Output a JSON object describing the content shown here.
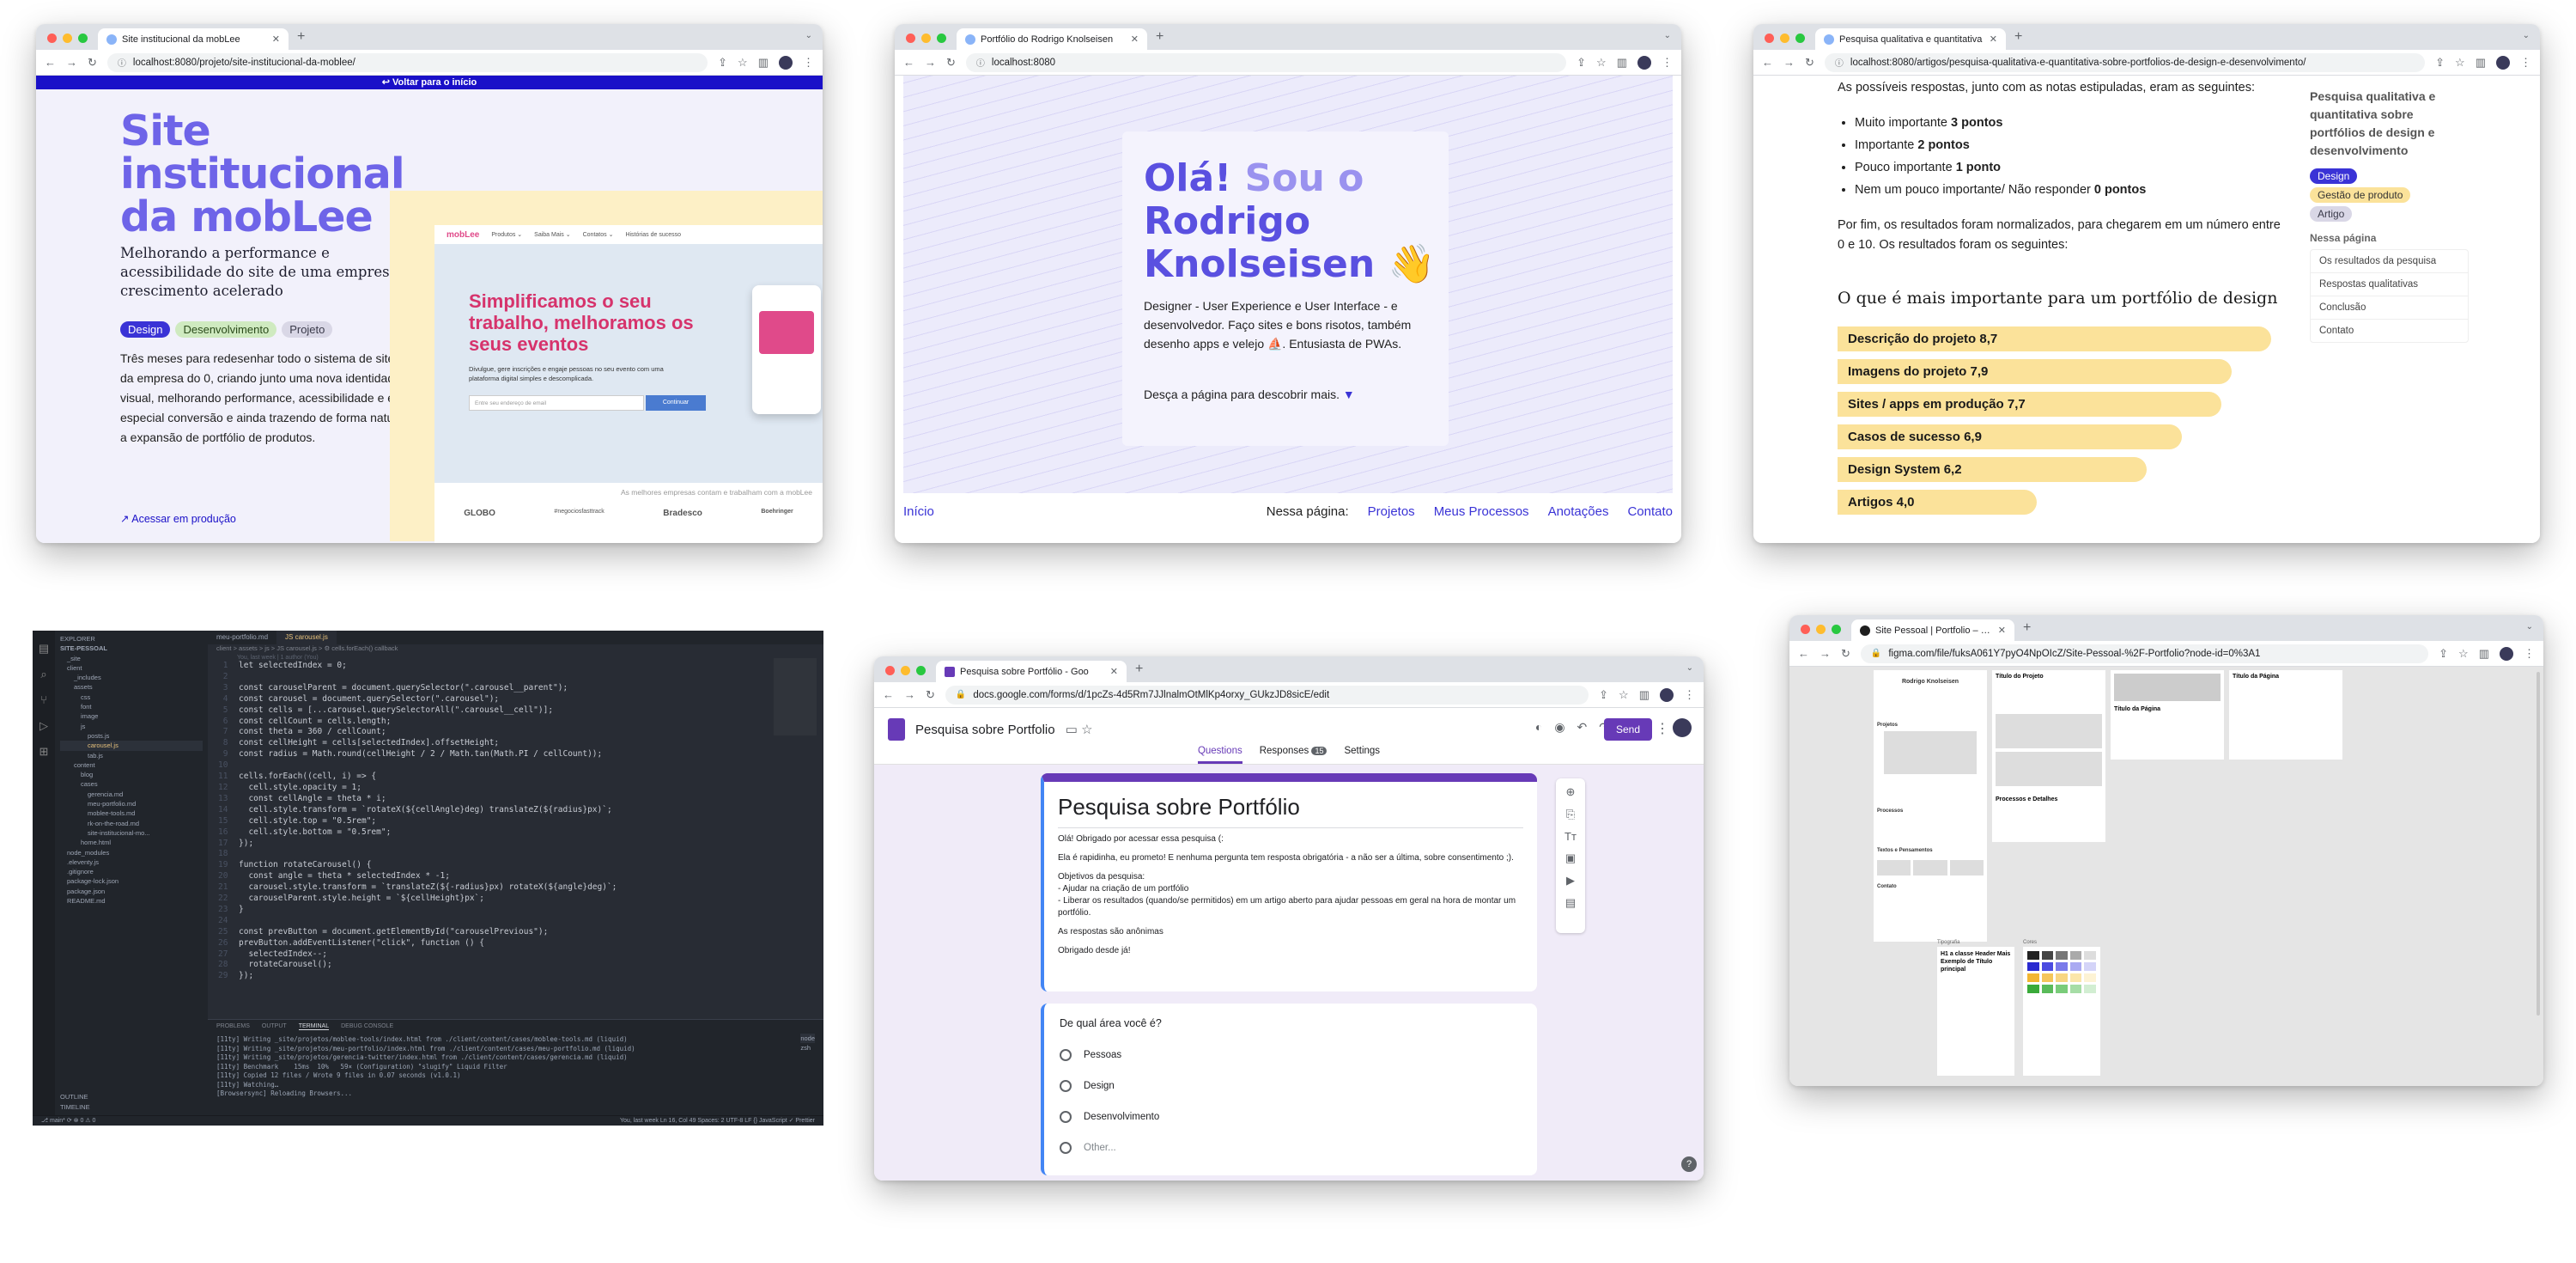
{
  "w1": {
    "tab_title": "Site institucional da mobLee",
    "url": "localhost:8080/projeto/site-institucional-da-moblee/",
    "banner": "↩ Voltar para o início",
    "title_lines": [
      "Site",
      "institucional",
      "da mobLee"
    ],
    "subtitle": "Melhorando a performance e acessibilidade do site de uma empresa em crescimento acelerado",
    "tags": [
      "Design",
      "Desenvolvimento",
      "Projeto"
    ],
    "body": "Três meses para redesenhar todo o sistema de sites da empresa do 0, criando junto uma nova identidade visual, melhorando performance, acessibilidade e em especial conversão e ainda trazendo de forma natural a expansão de portfólio de produtos.",
    "link": "↗ Acessar em produção",
    "mock": {
      "logo": "mobLee",
      "nav": [
        "Produtos ⌄",
        "Saiba Mais ⌄",
        "Contatos ⌄",
        "Histórias de sucesso"
      ],
      "headline": "Simplificamos o seu trabalho, melhoramos os seus eventos",
      "text": "Divulgue, gere inscrições e engaje pessoas no seu evento com uma plataforma digital simples e descomplicada.",
      "input_placeholder": "Entre seu endereço de email",
      "cta": "Continuar",
      "clients_caption": "As melhores empresas contam e trabalham com a mobLee",
      "clients": [
        "GLOBO",
        "#negociosfasttrack",
        "Bradesco",
        "Boehringer"
      ]
    }
  },
  "w2": {
    "tab_title": "Portfólio do Rodrigo Knolseisen",
    "url": "localhost:8080",
    "hero_lines": [
      "Olá! Sou o",
      "Rodrigo",
      "Knolseisen 👋"
    ],
    "hero_accent": [
      "Olá!",
      "Rodrigo",
      "Knolseisen"
    ],
    "desc": "Designer - User Experience e User Interface - e desenvolvedor. Faço sites e bons risotos, também desenho apps e velejo ⛵. Entusiasta de PWAs.",
    "cta": "Desça a página para descobrir mais.",
    "footer": {
      "home": "Início",
      "label": "Nessa página:",
      "links": [
        "Projetos",
        "Meus Processos",
        "Anotações",
        "Contato"
      ]
    }
  },
  "w3": {
    "tab_title": "Pesquisa qualitativa e quantitativa",
    "url": "localhost:8080/artigos/pesquisa-qualitativa-e-quantitativa-sobre-portfolios-de-design-e-desenvolvimento/",
    "intro": "As possíveis respostas, junto com as notas estipuladas, eram as seguintes:",
    "bullets": [
      {
        "text": "Muito importante",
        "b": "3 pontos"
      },
      {
        "text": "Importante",
        "b": "2 pontos"
      },
      {
        "text": "Pouco importante",
        "b": "1 ponto"
      },
      {
        "text": "Nem um pouco importante/ Não responder",
        "b": "0 pontos"
      }
    ],
    "after": "Por fim, os resultados foram normalizados, para chegarem em um número entre 0 e 10. Os resultados foram os seguintes:",
    "heading": "O que é mais importante para um portfólio de design",
    "chart_data": {
      "type": "bar",
      "title": "O que é mais importante para um portfólio de design",
      "categories": [
        "Descrição do projeto",
        "Imagens do projeto",
        "Sites / apps em produção",
        "Casos de sucesso",
        "Design System",
        "Artigos"
      ],
      "values": [
        8.7,
        7.9,
        7.7,
        6.9,
        6.2,
        4.0
      ],
      "labels": [
        "Descrição do projeto 8,7",
        "Imagens do projeto 7,9",
        "Sites / apps em produção 7,7",
        "Casos de sucesso 6,9",
        "Design System 6,2",
        "Artigos 4,0"
      ]
    },
    "sidebar": {
      "title": "Pesquisa qualitativa e quantitativa sobre portfólios de design e desenvolvimento",
      "tags": [
        "Design",
        "Gestão de produto",
        "Artigo"
      ],
      "nav_title": "Nessa página",
      "nav": [
        "Os resultados da pesquisa",
        "Respostas qualitativas",
        "Conclusão",
        "Contato"
      ]
    }
  },
  "editor": {
    "explorer": "EXPLORER",
    "project": "SITE-PESSOAL",
    "tree": [
      "_site",
      "client",
      "_includes",
      "assets",
      "css",
      "font",
      "image",
      "js",
      "posts.js",
      "carousel.js",
      "tab.js",
      "content",
      "blog",
      "cases",
      "gerencia.md",
      "meu-portfolio.md",
      "moblee-tools.md",
      "rk-on-the-road.md",
      "site-institucional-mo...",
      "home.html",
      "node_modules",
      ".eleventy.js",
      ".gitignore",
      "package-lock.json",
      "package.json",
      "README.md"
    ],
    "tabs": [
      "meu-portfolio.md",
      "JS carousel.js"
    ],
    "breadcrumb": "client > assets > js > JS carousel.js > ⚙ cells.forEach() callback",
    "blame": "You, last week | 1 author (You)",
    "code": [
      "let selectedIndex = 0;",
      "",
      "const carouselParent = document.querySelector(\".carousel__parent\");",
      "const carousel = document.querySelector(\".carousel\");",
      "const cells = [...carousel.querySelectorAll(\".carousel__cell\")];",
      "const cellCount = cells.length;",
      "const theta = 360 / cellCount;",
      "const cellHeight = cells[selectedIndex].offsetHeight;",
      "const radius = Math.round(cellHeight / 2 / Math.tan(Math.PI / cellCount));",
      "",
      "cells.forEach((cell, i) => {",
      "  cell.style.opacity = 1;",
      "  const cellAngle = theta * i;",
      "  cell.style.transform = `rotateX(${cellAngle}deg) translateZ(${radius}px)`;",
      "  cell.style.top = \"0.5rem\";",
      "  cell.style.bottom = \"0.5rem\";",
      "});",
      "",
      "function rotateCarousel() {",
      "  const angle = theta * selectedIndex * -1;",
      "  carousel.style.transform = `translateZ(${-radius}px) rotateX(${angle}deg)`;",
      "  carouselParent.style.height = `${cellHeight}px`;",
      "}",
      "",
      "const prevButton = document.getElementById(\"carouselPrevious\");",
      "prevButton.addEventListener(\"click\", function () {",
      "  selectedIndex--;",
      "  rotateCarousel();",
      "});"
    ],
    "panel_tabs": [
      "PROBLEMS",
      "OUTPUT",
      "TERMINAL",
      "DEBUG CONSOLE"
    ],
    "terminal": [
      "[11ty] Writing _site/projetos/moblee-tools/index.html from ./client/content/cases/moblee-tools.md (liquid)",
      "[11ty] Writing _site/projetos/meu-portfolio/index.html from ./client/content/cases/meu-portfolio.md (liquid)",
      "[11ty] Writing _site/projetos/gerencia-twitter/index.html from ./client/content/cases/gerencia.md (liquid)",
      "[11ty] Benchmark    15ms  10%   59× (Configuration) \"slugify\" Liquid Filter",
      "[11ty] Copied 12 files / Wrote 9 files in 0.07 seconds (v1.0.1)",
      "[11ty] Watching…",
      "[Browsersync] Reloading Browsers..."
    ],
    "term_list": [
      "node",
      "zsh"
    ],
    "status_left": "⎇ main*  ⟳  ⊗ 0 ⚠ 0",
    "status_right": "You, last week   Ln 16, Col 49   Spaces: 2   UTF-8   LF   {} JavaScript   ✓ Prettier",
    "outline": [
      "OUTLINE",
      "TIMELINE"
    ]
  },
  "forms": {
    "tab_title": "Pesquisa sobre Portfólio - Goo",
    "url": "docs.google.com/forms/d/1pcZs-4d5Rm7JJlnalmOtMlKp4orxy_GUkzJD8sicE/edit",
    "doc_title": "Pesquisa sobre Portfolio",
    "send": "Send",
    "tabs": [
      "Questions",
      "Responses",
      "Settings"
    ],
    "responses_count": "15",
    "form_title": "Pesquisa sobre Portfólio",
    "desc_lines": [
      "Olá! Obrigado por acessar essa pesquisa (:",
      "",
      "Ela é rapidinha, eu prometo! E nenhuma pergunta tem resposta obrigatória - a não ser a última, sobre consentimento ;).",
      "",
      "Objetivos da pesquisa:",
      "- Ajudar na criação de um portfólio",
      "- Liberar os resultados (quando/se permitidos) em um artigo aberto para ajudar pessoas em geral na hora de montar um portfólio.",
      "",
      "As respostas são anônimas",
      "",
      "Obrigado desde já!"
    ],
    "question": "De qual área você é?",
    "options": [
      "Pessoas",
      "Design",
      "Desenvolvimento",
      "Other..."
    ]
  },
  "figma": {
    "tab_title": "Site Pessoal | Portfolio – Figma",
    "url": "figma.com/file/fuksA061Y7pyO4NpOIcZ/Site-Pessoal-%2F-Portfolio?node-id=0%3A1",
    "frames": {
      "name": "Rodrigo Knolseisen",
      "projetos": "Projetos",
      "processos": "Processos",
      "textos": "Textos e Pensamentos",
      "contato": "Contato",
      "titulo_projeto": "Título do Projeto",
      "titulo_pagina": "Título da Página",
      "processos_detalhes": "Processos e Detalhes",
      "tipografia": "Tipografia",
      "cores": "Cores",
      "type_sample": "H1 a classe Header Mais Exemplo de Título principal"
    }
  },
  "colors": {
    "accent": "#3a33d6",
    "hero": "#6e64e8",
    "highlight": "#fbe29a",
    "forms_purple": "#673ab7"
  }
}
